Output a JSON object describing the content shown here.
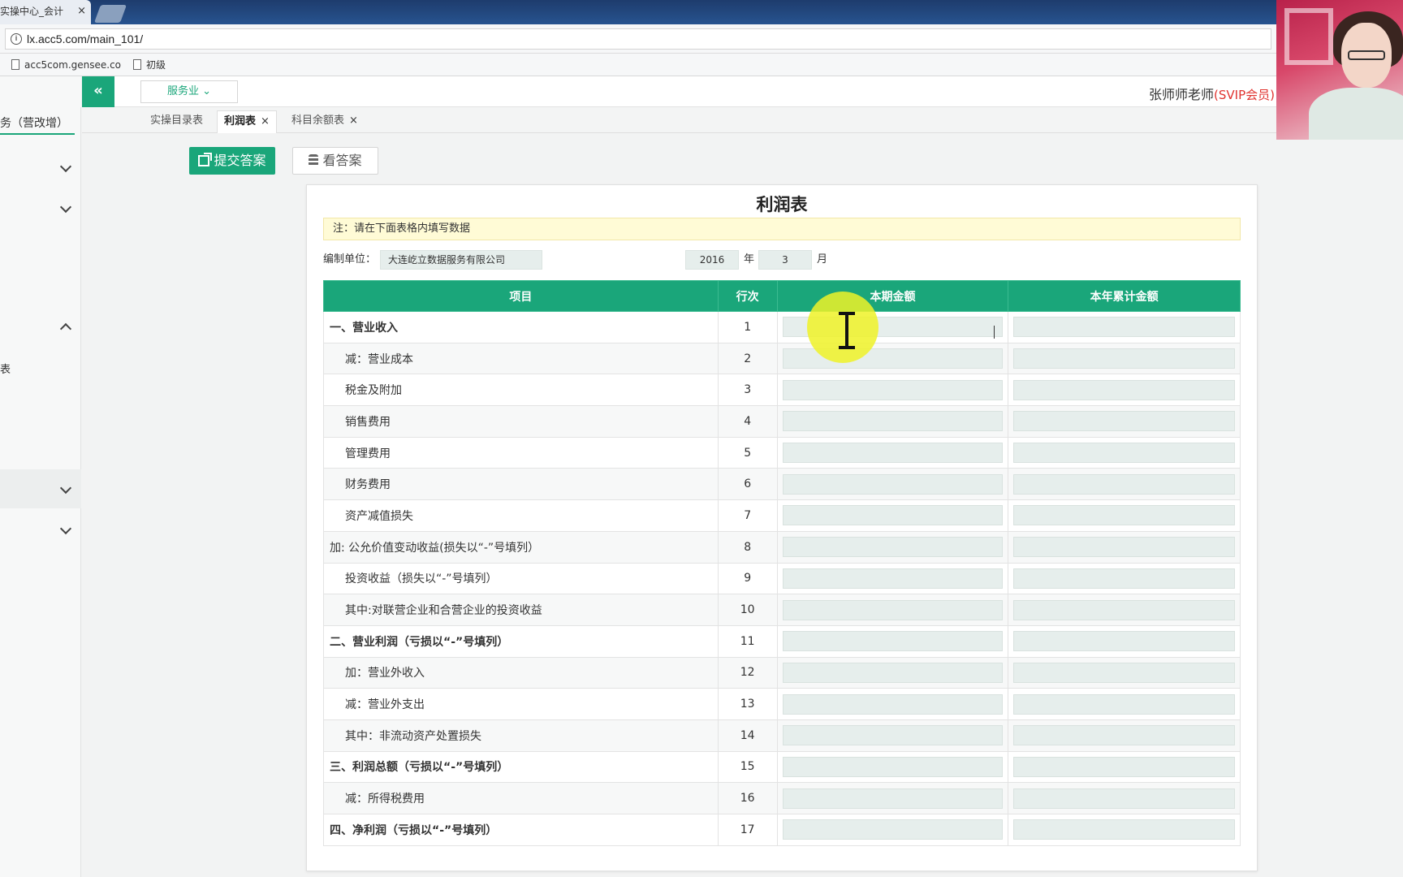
{
  "browser": {
    "tab_title": "实操中心_会计",
    "tab_close": "×",
    "url": "lx.acc5.com/main_101/",
    "bookmarks": [
      "acc5com.gensee.co",
      "初级"
    ]
  },
  "header": {
    "collapse_icon": "«",
    "industry_select": "服务业 ⌄",
    "user_name": "张师师老师",
    "user_badge": "(SVIP会员)"
  },
  "sidebar": {
    "title": "务（营改增）",
    "partial_item": "表"
  },
  "page_tabs": [
    {
      "label": "实操目录表",
      "close": ""
    },
    {
      "label": "利润表",
      "close": "×"
    },
    {
      "label": "科目余额表",
      "close": "×"
    }
  ],
  "actions": {
    "submit_label": "提交答案",
    "view_label": "看答案"
  },
  "report": {
    "title": "利润表",
    "notice": "注：请在下面表格内填写数据",
    "unit_label": "编制单位：",
    "unit_value": "大连屹立数据服务有限公司",
    "year_value": "2016",
    "year_label": "年",
    "month_value": "3",
    "month_label": "月",
    "columns": [
      "项目",
      "行次",
      "本期金额",
      "本年累计金额"
    ],
    "rows": [
      {
        "item": "一、营业收入",
        "line": "1",
        "style": "bold"
      },
      {
        "item": "减：营业成本",
        "line": "2",
        "style": "indent"
      },
      {
        "item": "税金及附加",
        "line": "3",
        "style": "indent"
      },
      {
        "item": "销售费用",
        "line": "4",
        "style": "indent"
      },
      {
        "item": "管理费用",
        "line": "5",
        "style": "indent"
      },
      {
        "item": "财务费用",
        "line": "6",
        "style": "indent"
      },
      {
        "item": "资产减值损失",
        "line": "7",
        "style": "indent"
      },
      {
        "item": "加: 公允价值变动收益(损失以“-”号填列）",
        "line": "8",
        "style": "plain"
      },
      {
        "item": "投资收益（损失以“-”号填列）",
        "line": "9",
        "style": "indent"
      },
      {
        "item": "其中:对联营企业和合营企业的投资收益",
        "line": "10",
        "style": "indent"
      },
      {
        "item": "二、营业利润（亏损以“-”号填列）",
        "line": "11",
        "style": "bold"
      },
      {
        "item": "加：营业外收入",
        "line": "12",
        "style": "indent"
      },
      {
        "item": "减：营业外支出",
        "line": "13",
        "style": "indent"
      },
      {
        "item": "其中：非流动资产处置损失",
        "line": "14",
        "style": "indent"
      },
      {
        "item": "三、利润总额（亏损以“-”号填列）",
        "line": "15",
        "style": "bold"
      },
      {
        "item": "减：所得税费用",
        "line": "16",
        "style": "indent"
      },
      {
        "item": "四、净利润（亏损以“-”号填列）",
        "line": "17",
        "style": "bold"
      }
    ]
  },
  "colors": {
    "accent": "#1aa67a",
    "input_bg": "#e6eeec",
    "notice_bg": "#fffbd6",
    "vip_red": "#e0332f"
  },
  "icons": {
    "submit": "external-link-icon",
    "view": "database-icon",
    "collapse": "double-chevron-left-icon"
  }
}
